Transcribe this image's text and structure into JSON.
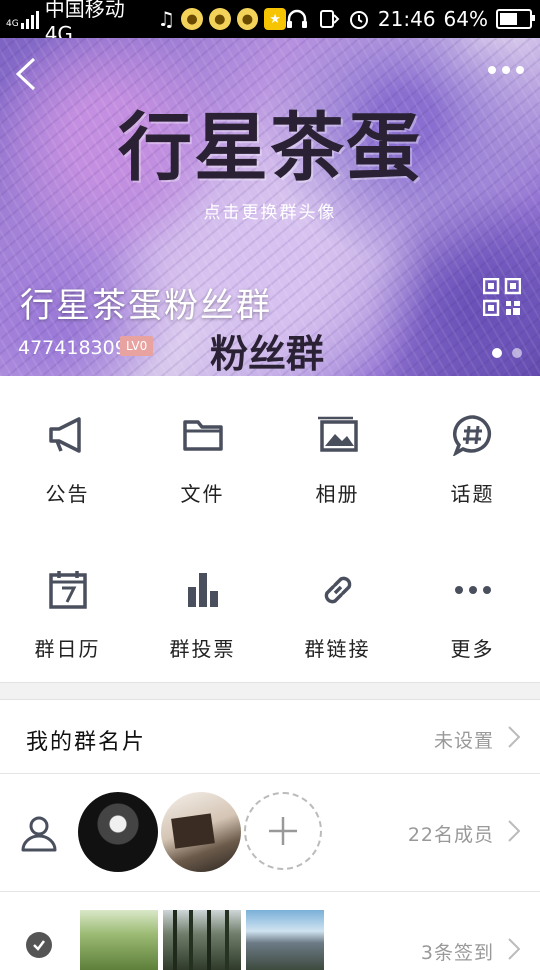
{
  "status_bar": {
    "carrier": "中国移动4G",
    "net_tag_top": "4G",
    "time": "21:46",
    "battery": "64%",
    "battery_level": 0.64,
    "icons": [
      "signal-icon",
      "music-icon",
      "qq-notification-icon",
      "star-app-icon",
      "headphones-icon",
      "screen-rotate-icon",
      "alarm-icon",
      "battery-icon"
    ]
  },
  "header": {
    "banner_title": "行星茶蛋",
    "change_avatar_hint": "点击更换群头像",
    "group_name": "行星茶蛋粉丝群",
    "banner_subtitle": "粉丝群",
    "group_id": "477418309",
    "level_badge": "LV0",
    "pager_total": 2,
    "pager_active": 1
  },
  "features": {
    "row1": [
      {
        "label": "公告",
        "icon": "megaphone-icon"
      },
      {
        "label": "文件",
        "icon": "folder-icon"
      },
      {
        "label": "相册",
        "icon": "album-icon"
      },
      {
        "label": "话题",
        "icon": "hashtag-chat-icon"
      }
    ],
    "row2": [
      {
        "label": "群日历",
        "icon": "calendar-icon"
      },
      {
        "label": "群投票",
        "icon": "bar-chart-icon"
      },
      {
        "label": "群链接",
        "icon": "link-icon"
      },
      {
        "label": "更多",
        "icon": "more-dots-icon"
      }
    ]
  },
  "group_card": {
    "title": "我的群名片",
    "value": "未设置"
  },
  "members": {
    "count_text": "22名成员"
  },
  "checkin": {
    "count_text": "3条签到"
  },
  "colors": {
    "icon": "#4a4f5e",
    "secondary_text": "#999999",
    "level_badge": "#e8a3a0"
  }
}
